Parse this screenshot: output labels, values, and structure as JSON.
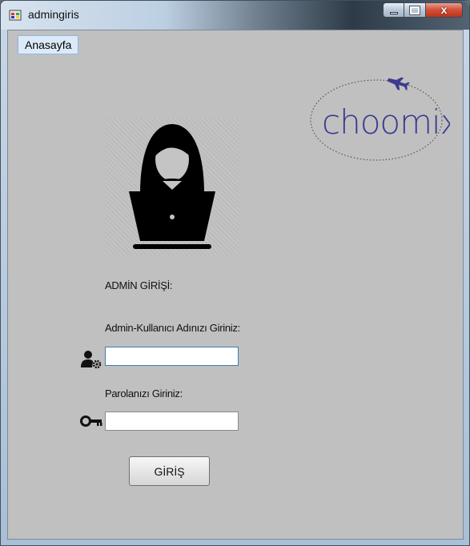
{
  "window": {
    "title": "admingiris",
    "controls": {
      "minimize": "minimize",
      "maximize": "maximize",
      "close": "x"
    }
  },
  "menu": {
    "items": [
      {
        "label": "Anasayfa"
      }
    ]
  },
  "logo": {
    "text": "choomix",
    "icon": "airplane-icon"
  },
  "avatar": {
    "icon": "woman-at-laptop-icon"
  },
  "form": {
    "heading": "ADMİN GİRİŞİ:",
    "username_label": "Admin-Kullanıcı Adınızı Giriniz:",
    "username_value": "",
    "username_icon": "user-gear-icon",
    "password_label": "Parolanızı Giriniz:",
    "password_value": "",
    "password_icon": "key-icon",
    "submit_label": "GİRİŞ"
  },
  "colors": {
    "background": "#c0c0c0",
    "logo": "#3b3b8f",
    "icon": "#111111"
  }
}
